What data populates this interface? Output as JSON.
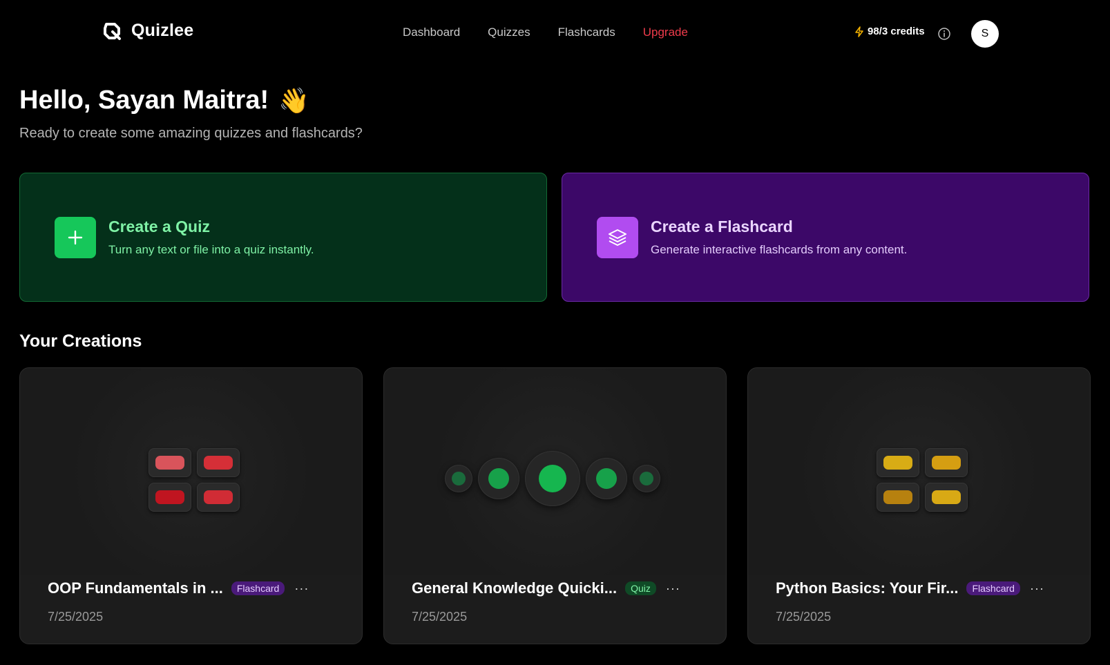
{
  "brand": {
    "name": "Quizlee",
    "icon": "quizlee-logo-icon"
  },
  "nav": {
    "links": [
      {
        "label": "Dashboard"
      },
      {
        "label": "Quizzes"
      },
      {
        "label": "Flashcards"
      },
      {
        "label": "Upgrade",
        "accent": "#ef3b4b"
      }
    ]
  },
  "account": {
    "credits_label": "98/3 credits",
    "bolt_color": "#f5b300",
    "avatar_initial": "S"
  },
  "greeting": {
    "title": "Hello, Sayan Maitra!",
    "emoji": "👋",
    "subtitle": "Ready to create some amazing quizzes and flashcards?"
  },
  "actions": [
    {
      "title": "Create a Quiz",
      "description": "Turn any text or file into a quiz instantly.",
      "icon": "plus-icon",
      "color": "#16c75a"
    },
    {
      "title": "Create a Flashcard",
      "description": "Generate interactive flashcards from any content.",
      "icon": "layers-icon",
      "color": "#b14cf0"
    }
  ],
  "creations": {
    "section_title": "Your Creations",
    "items": [
      {
        "title": "OOP Fundamentals in ...",
        "type": "Flashcard",
        "date": "7/25/2025",
        "preview": "flashcard-grid",
        "colors": [
          "#d9545b",
          "#d52f37",
          "#c01520",
          "#d02c35"
        ]
      },
      {
        "title": "General Knowledge Quicki...",
        "type": "Quiz",
        "date": "7/25/2025",
        "preview": "quiz-dots",
        "colors": [
          "#1a6b3c",
          "#17a14a",
          "#16b64f",
          "#17a14a",
          "#1a6b3c"
        ]
      },
      {
        "title": "Python Basics: Your Fir...",
        "type": "Flashcard",
        "date": "7/25/2025",
        "preview": "flashcard-grid",
        "colors": [
          "#d8ac15",
          "#d59e12",
          "#b7810f",
          "#d8a915"
        ]
      }
    ],
    "more_label": "···"
  }
}
